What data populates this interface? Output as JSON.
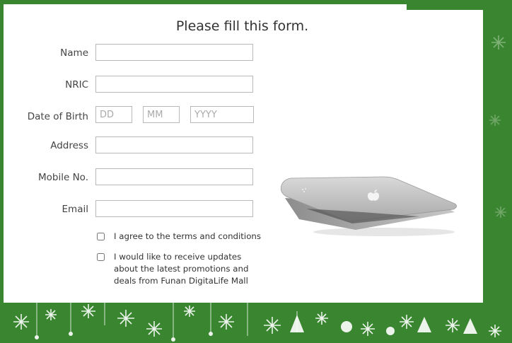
{
  "form": {
    "title": "Please fill this form.",
    "fields": {
      "name": {
        "label": "Name",
        "value": ""
      },
      "nric": {
        "label": "NRIC",
        "value": ""
      },
      "dob": {
        "label": "Date of Birth",
        "day_placeholder": "DD",
        "month_placeholder": "MM",
        "year_placeholder": "YYYY"
      },
      "address": {
        "label": "Address",
        "value": ""
      },
      "mobile": {
        "label": "Mobile No.",
        "value": ""
      },
      "email": {
        "label": "Email",
        "value": ""
      }
    },
    "checkboxes": [
      {
        "label": "I agree to the terms and conditions",
        "checked": false
      },
      {
        "label": "I would like to receive updates about the latest promotions and deals from Funan DigitaLife Mall",
        "checked": false
      }
    ]
  },
  "colors": {
    "background_green": "#3a8630",
    "card": "#ffffff",
    "input_border": "#b8b8b8"
  },
  "images": {
    "product": "laptop-image",
    "decoration": "christmas-snowflake-border"
  }
}
